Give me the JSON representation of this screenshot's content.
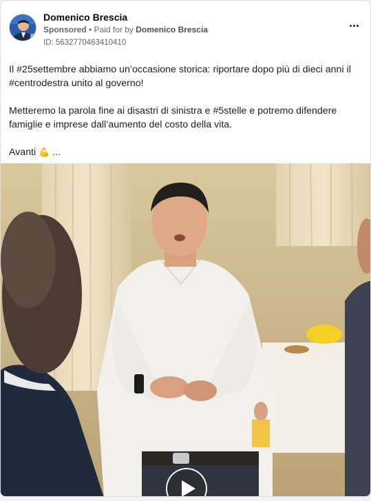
{
  "post": {
    "author": "Domenico Brescia",
    "sponsored_label": "Sponsored",
    "separator": " • ",
    "paid_for_prefix": "Paid for by ",
    "paid_for_by": "Domenico Brescia",
    "ad_id": "ID: 5632770463410410",
    "text_line_1": "Il #25settembre abbiamo un’occasione storica: riportare dopo più di dieci anni il",
    "text_line_2": "#centrodestra unito al governo!",
    "text_line_3": "Metteremo la parola fine ai disastri di sinistra e #5stelle e potremo difendere",
    "text_line_4": "famiglie e imprese dall’aumento del costo della vita.",
    "text_line_5": "Avanti",
    "text_emoji": "💪",
    "text_ellipsis": " ..."
  },
  "icons": {
    "more": "more-options-icon",
    "play": "play-icon"
  },
  "colors": {
    "text_primary": "#1c1e21",
    "text_secondary": "#65676b",
    "card_border": "#dadde1"
  }
}
